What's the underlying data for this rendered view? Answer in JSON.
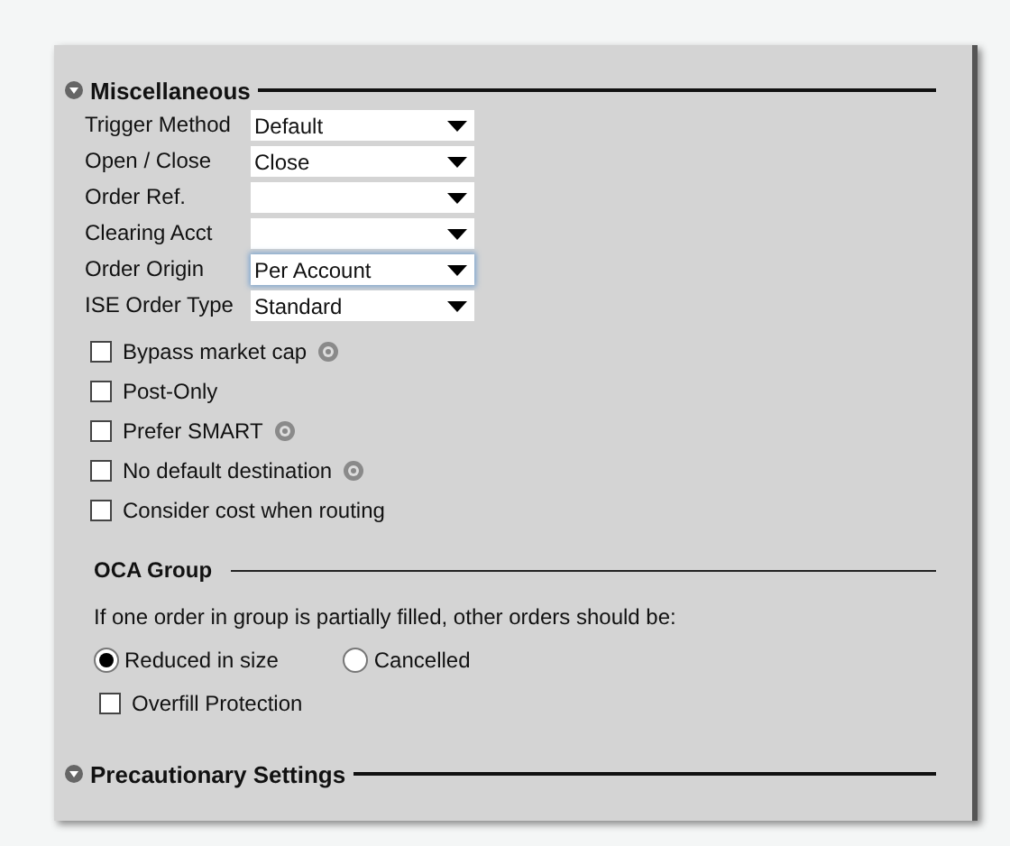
{
  "sections": [
    {
      "title": "Miscellaneous",
      "expanded": true
    },
    {
      "title": "Precautionary Settings",
      "expanded": true
    }
  ],
  "fields": [
    {
      "label": "Trigger Method",
      "value": "Default",
      "focused": false
    },
    {
      "label": "Open / Close",
      "value": "Close",
      "focused": false
    },
    {
      "label": "Order Ref.",
      "focused": false
    },
    {
      "label": "Clearing Acct",
      "focused": false
    },
    {
      "label": "Order Origin",
      "value": "Per Account",
      "focused": true
    },
    {
      "label": "ISE Order Type",
      "value": "Standard",
      "focused": false
    }
  ],
  "options": [
    {
      "label": "Bypass market cap",
      "checked": false,
      "help": true
    },
    {
      "label": "Post-Only",
      "checked": false,
      "help": false
    },
    {
      "label": "Prefer SMART",
      "checked": false,
      "help": true
    },
    {
      "label": "No default destination",
      "checked": false,
      "help": true
    },
    {
      "label": "Consider cost when routing",
      "checked": false,
      "help": false
    }
  ],
  "oca_group": {
    "title": "OCA Group",
    "prompt": "If one order in group is partially filled, other orders should be:",
    "choices": [
      {
        "label": "Reduced in size",
        "selected": true
      },
      {
        "label": "Cancelled",
        "selected": false
      }
    ],
    "overfill": {
      "label": "Overfill Protection",
      "checked": false
    }
  }
}
